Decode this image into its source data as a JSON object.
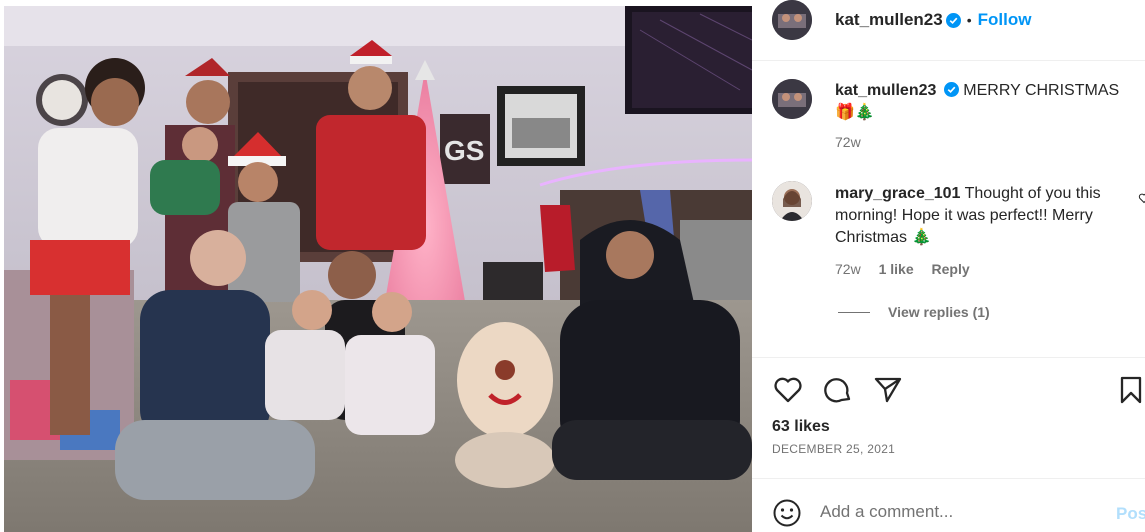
{
  "post": {
    "username": "kat_mullen23",
    "follow_label": "Follow",
    "dot": "•",
    "caption": "MERRY CHRISTMAS",
    "caption_emoji": "🎁🎄",
    "caption_age": "72w",
    "likes": "63 likes",
    "date": "DECEMBER 25, 2021"
  },
  "comment": {
    "username": "mary_grace_101",
    "text": "Thought of you this morning! Hope it was perfect!! Merry Christmas",
    "emoji": "🎄",
    "age": "72w",
    "likes": "1 like",
    "reply_label": "Reply",
    "view_replies": "View replies (1)"
  },
  "add_comment": {
    "placeholder": "Add a comment...",
    "post_label": "Pos"
  },
  "icons": {
    "verified": "verified-badge-icon",
    "like": "heart-icon",
    "comment": "comment-bubble-icon",
    "share": "paper-plane-icon",
    "save": "bookmark-icon",
    "emoji": "smiley-icon",
    "comment_like": "small-heart-icon"
  },
  "colors": {
    "link_blue": "#0095f6",
    "verified_blue": "#0095f6",
    "muted_text": "#737373",
    "post_disabled": "#b2dffc"
  }
}
